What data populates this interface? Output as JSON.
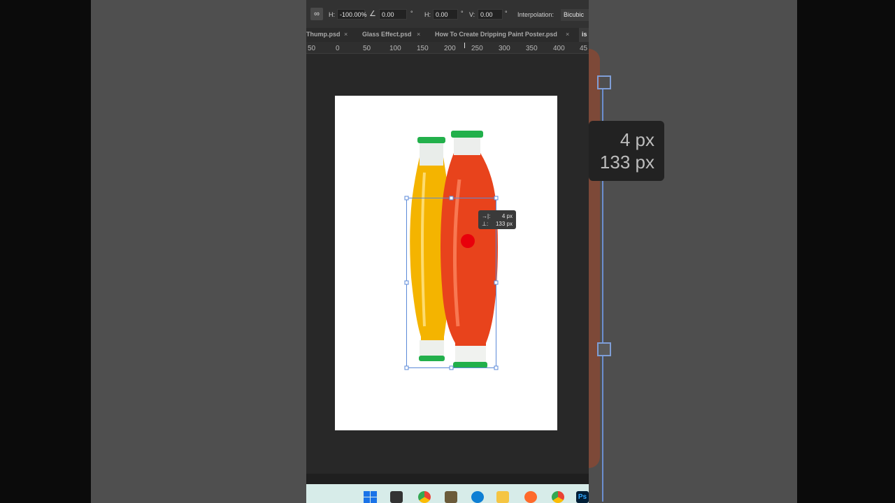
{
  "options_bar": {
    "link_icon": "link-icon",
    "height_label": "H:",
    "height_value": "-100.00%",
    "angle_icon": "angle-icon",
    "angle_value": "0.00",
    "degree_symbol": "°",
    "h_skew_label": "H:",
    "h_skew_value": "0.00",
    "v_skew_label": "V:",
    "v_skew_value": "0.00",
    "interpolation_label": "Interpolation:",
    "interpolation_value": "Bicubic"
  },
  "tabs": [
    {
      "label": "Thump.psd"
    },
    {
      "label": "Glass Effect.psd"
    },
    {
      "label": "How To Create Dripping Paint Poster.psd"
    },
    {
      "label": "is"
    }
  ],
  "close_glyph": "×",
  "ruler": {
    "ticks": [
      "50",
      "0",
      "50",
      "100",
      "150",
      "200",
      "250",
      "300",
      "350",
      "400",
      "45"
    ]
  },
  "transform_hud": {
    "x_value": "4 px",
    "y_value": "133 px",
    "x_icon": "horizontal-offset-icon",
    "y_icon": "vertical-offset-icon"
  },
  "zoom_hud": {
    "x_value": "4 px",
    "y_value": "133 px"
  },
  "colors": {
    "accent_cursor": "#e8000b",
    "bottle_yellow": "#f4b400",
    "bottle_red": "#e8431c",
    "cap_green": "#22b04b"
  },
  "taskbar_icons": [
    "windows-start-icon",
    "task-view-icon",
    "chrome-icon",
    "app-icon",
    "edge-icon",
    "file-explorer-icon",
    "firefox-icon",
    "chrome-alt-icon",
    "photoshop-icon"
  ]
}
